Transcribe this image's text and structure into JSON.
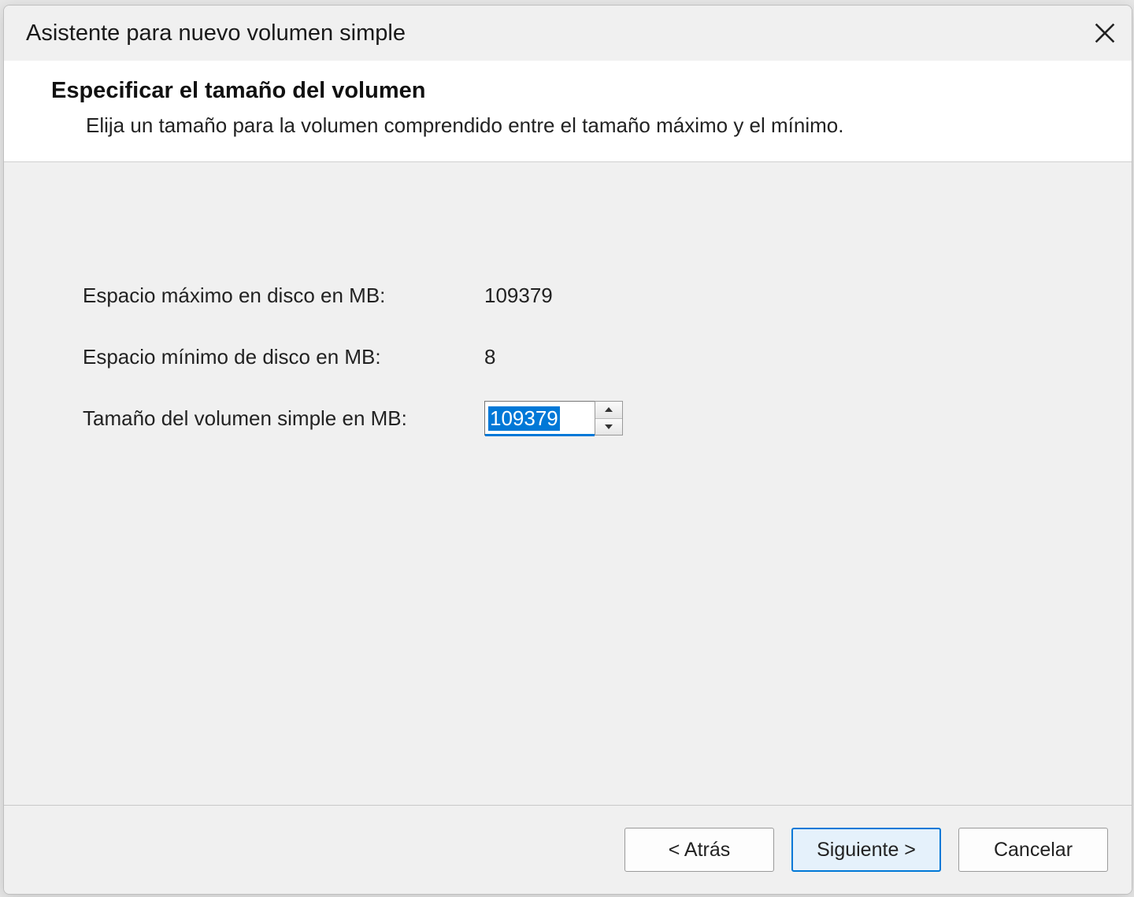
{
  "window": {
    "title": "Asistente para nuevo volumen simple"
  },
  "header": {
    "title": "Especificar el tamaño del volumen",
    "description": "Elija un tamaño para la volumen comprendido entre el tamaño máximo y el mínimo."
  },
  "form": {
    "max_label": "Espacio máximo en disco en MB:",
    "max_value": "109379",
    "min_label": "Espacio mínimo de disco en MB:",
    "min_value": "8",
    "size_label": "Tamaño del volumen simple en MB:",
    "size_value": "109379"
  },
  "footer": {
    "back": "< Atrás",
    "next": "Siguiente >",
    "cancel": "Cancelar"
  }
}
